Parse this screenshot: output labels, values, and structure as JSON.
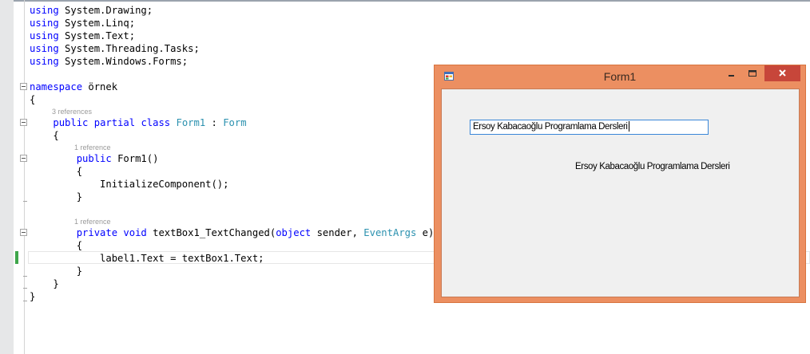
{
  "editor": {
    "lines": [
      {
        "parts": [
          {
            "t": "using",
            "c": "kw"
          },
          {
            "t": " System.Drawing;",
            "c": ""
          }
        ]
      },
      {
        "parts": [
          {
            "t": "using",
            "c": "kw"
          },
          {
            "t": " System.Linq;",
            "c": ""
          }
        ]
      },
      {
        "parts": [
          {
            "t": "using",
            "c": "kw"
          },
          {
            "t": " System.Text;",
            "c": ""
          }
        ]
      },
      {
        "parts": [
          {
            "t": "using",
            "c": "kw"
          },
          {
            "t": " System.Threading.Tasks;",
            "c": ""
          }
        ]
      },
      {
        "parts": [
          {
            "t": "using",
            "c": "kw"
          },
          {
            "t": " System.Windows.Forms;",
            "c": ""
          }
        ]
      },
      {
        "parts": [
          {
            "t": "namespace",
            "c": "kw"
          },
          {
            "t": " örnek",
            "c": ""
          }
        ]
      },
      {
        "parts": [
          {
            "t": "{",
            "c": ""
          }
        ]
      },
      {
        "parts": [
          {
            "t": "    ",
            "c": ""
          },
          {
            "t": "public",
            "c": "kw"
          },
          {
            "t": " ",
            "c": ""
          },
          {
            "t": "partial",
            "c": "kw"
          },
          {
            "t": " ",
            "c": ""
          },
          {
            "t": "class",
            "c": "kw"
          },
          {
            "t": " ",
            "c": ""
          },
          {
            "t": "Form1",
            "c": "type"
          },
          {
            "t": " : ",
            "c": ""
          },
          {
            "t": "Form",
            "c": "type"
          }
        ]
      },
      {
        "parts": [
          {
            "t": "    {",
            "c": ""
          }
        ]
      },
      {
        "parts": [
          {
            "t": "        ",
            "c": ""
          },
          {
            "t": "public",
            "c": "kw"
          },
          {
            "t": " Form1()",
            "c": ""
          }
        ]
      },
      {
        "parts": [
          {
            "t": "        {",
            "c": ""
          }
        ]
      },
      {
        "parts": [
          {
            "t": "            InitializeComponent();",
            "c": ""
          }
        ]
      },
      {
        "parts": [
          {
            "t": "        }",
            "c": ""
          }
        ]
      },
      {
        "parts": [
          {
            "t": "        ",
            "c": ""
          },
          {
            "t": "private",
            "c": "kw"
          },
          {
            "t": " ",
            "c": ""
          },
          {
            "t": "void",
            "c": "kw"
          },
          {
            "t": " textBox1_TextChanged(",
            "c": ""
          },
          {
            "t": "object",
            "c": "kw"
          },
          {
            "t": " sender, ",
            "c": ""
          },
          {
            "t": "EventArgs",
            "c": "type"
          },
          {
            "t": " e)",
            "c": ""
          }
        ]
      },
      {
        "parts": [
          {
            "t": "        {",
            "c": ""
          }
        ]
      },
      {
        "parts": [
          {
            "t": "            label1.Text = textBox1.Text;",
            "c": ""
          }
        ]
      },
      {
        "parts": [
          {
            "t": "        }",
            "c": ""
          }
        ]
      },
      {
        "parts": [
          {
            "t": "    }",
            "c": ""
          }
        ]
      },
      {
        "parts": [
          {
            "t": "}",
            "c": ""
          }
        ]
      }
    ],
    "codelens": {
      "class_refs": "3 references",
      "ctor_refs": "1 reference",
      "handler_refs": "1 reference"
    }
  },
  "form": {
    "title": "Form1",
    "textbox_value": "Ersoy Kabacaoğlu Programlama Dersleri",
    "label_text": "Ersoy Kabacaoğlu Programlama Dersleri"
  },
  "colors": {
    "keyword": "#0000ff",
    "type": "#2b91af",
    "window_frame": "#ec8f61",
    "close_button": "#c7463a",
    "focus_border": "#3a87d8"
  },
  "icons": [
    "app-icon",
    "minimize-icon",
    "maximize-icon",
    "close-icon",
    "fold-icon"
  ]
}
